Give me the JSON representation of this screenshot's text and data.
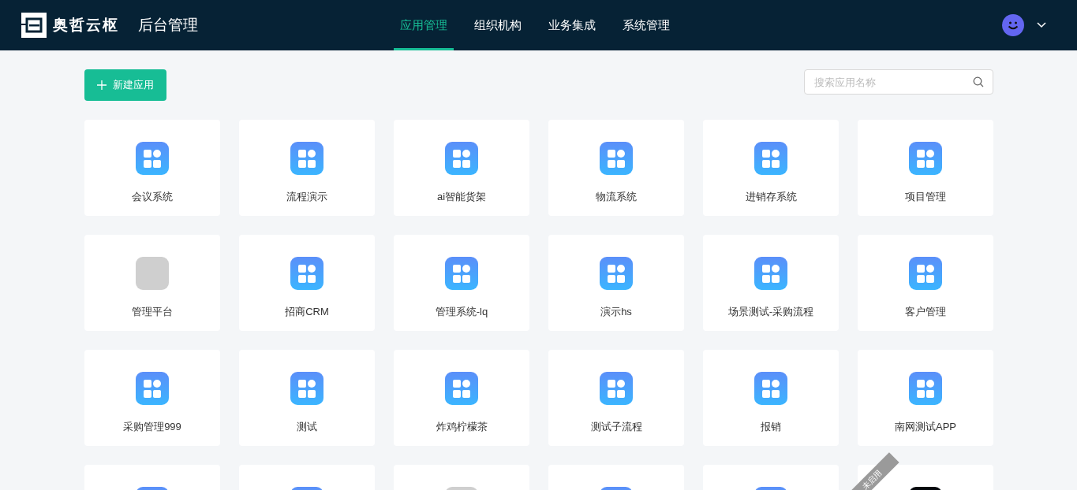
{
  "header": {
    "brand": "奥哲云枢",
    "title": "后台管理",
    "nav": [
      {
        "label": "应用管理",
        "selected": true
      },
      {
        "label": "组织机构",
        "selected": false
      },
      {
        "label": "业务集成",
        "selected": false
      },
      {
        "label": "系统管理",
        "selected": false
      }
    ]
  },
  "toolbar": {
    "new_button": "新建应用",
    "search": {
      "placeholder": "搜索应用名称"
    }
  },
  "apps": [
    {
      "name": "会议系统",
      "kind": "grid"
    },
    {
      "name": "流程演示",
      "kind": "grid"
    },
    {
      "name": "ai智能货架",
      "kind": "grid"
    },
    {
      "name": "物流系统",
      "kind": "grid"
    },
    {
      "name": "进销存系统",
      "kind": "grid"
    },
    {
      "name": "项目管理",
      "kind": "grid"
    },
    {
      "name": "管理平台",
      "kind": "photo"
    },
    {
      "name": "招商CRM",
      "kind": "grid"
    },
    {
      "name": "管理系统-lq",
      "kind": "grid"
    },
    {
      "name": "演示hs",
      "kind": "grid"
    },
    {
      "name": "场景测试-采购流程",
      "kind": "grid"
    },
    {
      "name": "客户管理",
      "kind": "grid"
    },
    {
      "name": "采购管理999",
      "kind": "grid"
    },
    {
      "name": "测试",
      "kind": "grid"
    },
    {
      "name": "炸鸡柠檬茶",
      "kind": "grid"
    },
    {
      "name": "测试子流程",
      "kind": "grid"
    },
    {
      "name": "报销",
      "kind": "grid"
    },
    {
      "name": "南网测试APP",
      "kind": "grid"
    },
    {
      "kind": "grid"
    },
    {
      "kind": "grid"
    },
    {
      "kind": "photo"
    },
    {
      "kind": "grid"
    },
    {
      "kind": "grid"
    },
    {
      "kind": "dark",
      "ribbon": "未启用"
    }
  ]
}
